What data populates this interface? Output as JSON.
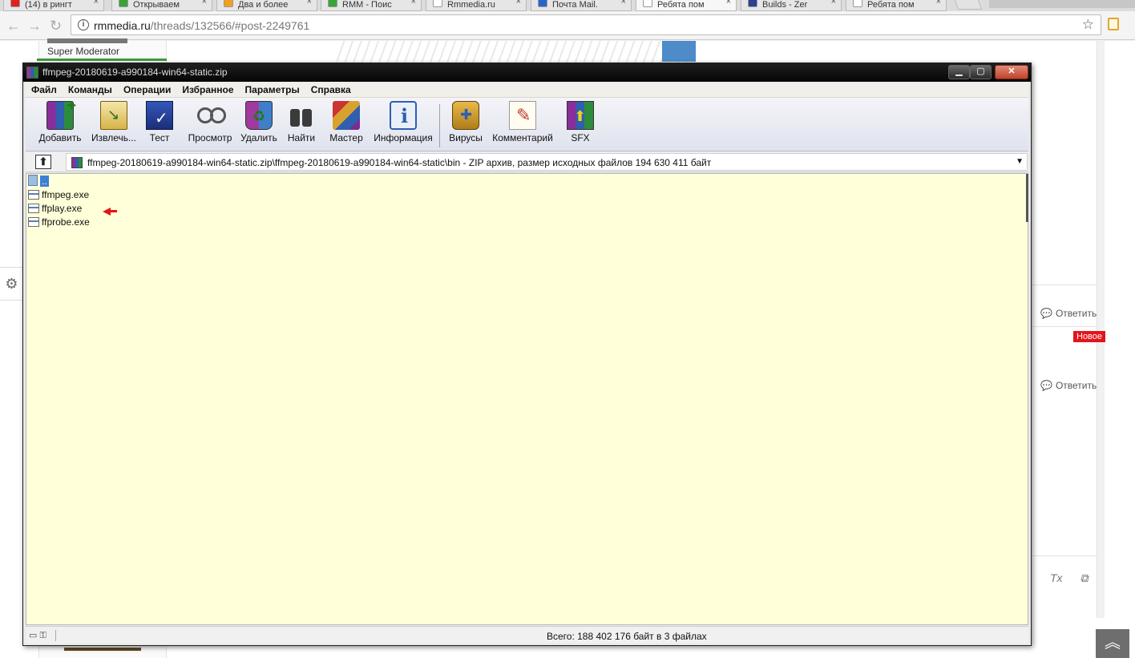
{
  "browser": {
    "tabs": [
      {
        "title": "(14) в рингт",
        "fav": "#e02020"
      },
      {
        "title": "Открываем",
        "fav": "#3aa33a"
      },
      {
        "title": "Два и более",
        "fav": "#f0a020"
      },
      {
        "title": "RMM - Поис",
        "fav": "#3aa33a"
      },
      {
        "title": "Rmmedia.ru",
        "fav": "#ffffff"
      },
      {
        "title": "Почта Mail.",
        "fav": "#2a66c9"
      },
      {
        "title": "Ребята пом",
        "fav": "#ffffff",
        "active": true
      },
      {
        "title": "Builds - Zer",
        "fav": "#2a3f8f"
      },
      {
        "title": "Ребята пом",
        "fav": "#ffffff"
      }
    ],
    "url_host": "rmmedia.ru",
    "url_path": "/threads/132566/#post-2249761"
  },
  "webpage": {
    "user_role": "Super Moderator",
    "reply_label": "Ответить",
    "new_badge": "Новое",
    "editor_icons": [
      "Tx",
      "⧉"
    ]
  },
  "winrar": {
    "title": "ffmpeg-20180619-a990184-win64-static.zip",
    "window_buttons": {
      "min": "▁",
      "max": "▢",
      "close": "✕"
    },
    "menu": [
      "Файл",
      "Команды",
      "Операции",
      "Избранное",
      "Параметры",
      "Справка"
    ],
    "tools": [
      {
        "label": "Добавить",
        "icon": "add-icon"
      },
      {
        "label": "Извлечь...",
        "icon": "extract-icon"
      },
      {
        "label": "Тест",
        "icon": "test-icon"
      },
      {
        "label": "Просмотр",
        "icon": "view-icon"
      },
      {
        "label": "Удалить",
        "icon": "delete-icon"
      },
      {
        "label": "Найти",
        "icon": "find-icon"
      },
      {
        "label": "Мастер",
        "icon": "wizard-icon"
      },
      {
        "label": "Информация",
        "icon": "info-icon"
      },
      {
        "label": "Вирусы",
        "icon": "virus-icon"
      },
      {
        "label": "Комментарий",
        "icon": "comment-icon"
      },
      {
        "label": "SFX",
        "icon": "sfx-icon"
      }
    ],
    "path": "ffmpeg-20180619-a990184-win64-static.zip\\ffmpeg-20180619-a990184-win64-static\\bin - ZIP архив, размер исходных файлов 194 630 411 байт",
    "files": [
      {
        "name": "..",
        "parent": true
      },
      {
        "name": "ffmpeg.exe"
      },
      {
        "name": "ffplay.exe"
      },
      {
        "name": "ffprobe.exe"
      }
    ],
    "status": "Всего: 188 402 176 байт в 3 файлах"
  }
}
